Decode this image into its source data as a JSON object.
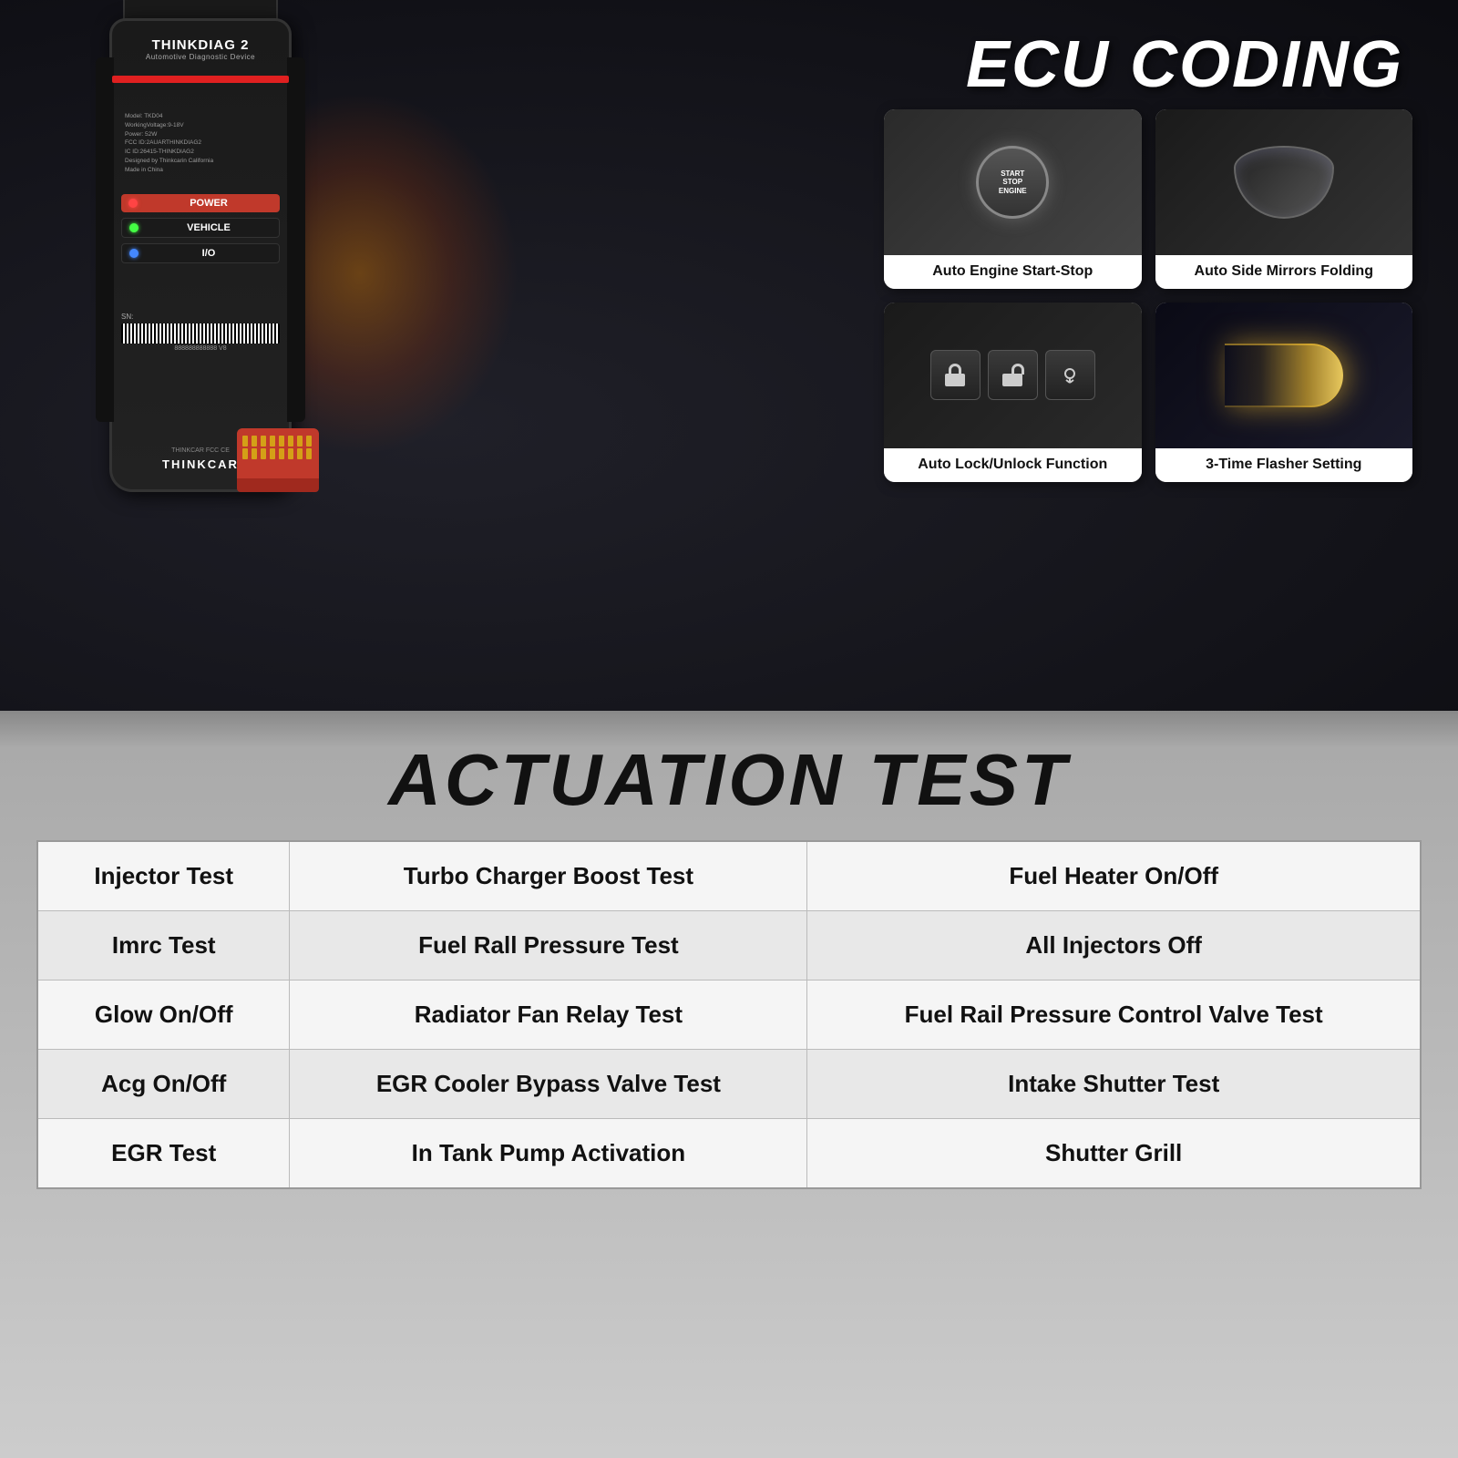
{
  "top": {
    "ecu_title": "ECU CODING",
    "features": [
      {
        "id": "auto-engine-start-stop",
        "label": "Auto Engine\nStart-Stop",
        "type": "start-stop"
      },
      {
        "id": "auto-side-mirrors",
        "label": "Auto Side\nMirrors Folding",
        "type": "mirror"
      },
      {
        "id": "auto-lock-unlock",
        "label": "Auto Lock/Unlock\nFunction",
        "type": "lock"
      },
      {
        "id": "three-time-flasher",
        "label": "3-Time Flasher\nSetting",
        "type": "flasher"
      }
    ],
    "device": {
      "name": "THINKDIAG 2",
      "subtitle": "Automotive Diagnostic Device",
      "model": "Model: TKD04",
      "voltage": "WorkingVoltage:9-18V",
      "power": "Power: 52W",
      "fcc": "FCC ID:2AUARTHINKDIAG2",
      "ic": "IC ID:26415-THINKDIAG2",
      "designed": "Designed by Thinkcarin California",
      "made": "Made in China",
      "leds": [
        {
          "label": "POWER",
          "color": "red",
          "bg": "red"
        },
        {
          "label": "VEHICLE",
          "color": "green",
          "bg": "dark"
        },
        {
          "label": "I/O",
          "color": "blue",
          "bg": "dark"
        }
      ],
      "sn_prefix": "SN:",
      "sn_number": "888888888888  V8",
      "brand": "THINKCAR"
    }
  },
  "bottom": {
    "section_title": "ACTUATION TEST",
    "table": {
      "rows": [
        {
          "col1": "Injector Test",
          "col2": "Turbo Charger Boost Test",
          "col3": "Fuel Heater On/Off"
        },
        {
          "col1": "Imrc Test",
          "col2": "Fuel Rall Pressure Test",
          "col3": "All Injectors Off"
        },
        {
          "col1": "Glow On/Off",
          "col2": "Radiator Fan Relay Test",
          "col3": "Fuel Rail Pressure Control\nValve Test"
        },
        {
          "col1": "Acg On/Off",
          "col2": "EGR Cooler Bypass\nValve Test",
          "col3": "Intake Shutter Test"
        },
        {
          "col1": "EGR Test",
          "col2": "In Tank Pump Activation",
          "col3": "Shutter Grill"
        }
      ]
    }
  }
}
